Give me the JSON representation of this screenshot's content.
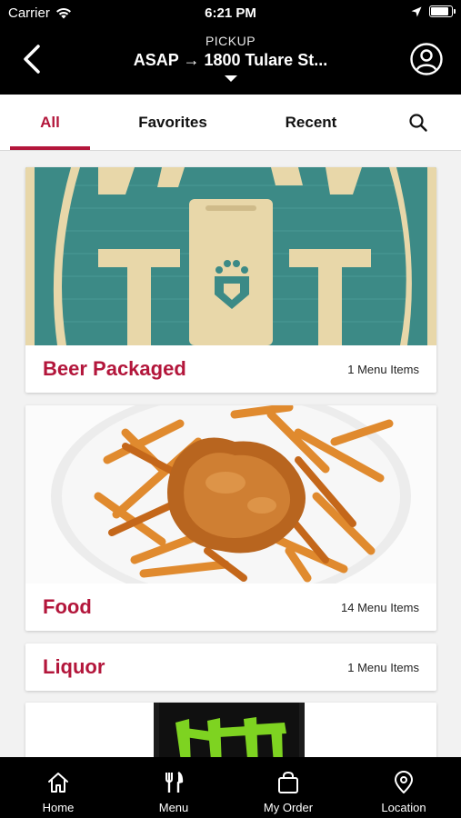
{
  "status_bar": {
    "carrier": "Carrier",
    "time": "6:21 PM",
    "battery_level": 0.92
  },
  "header": {
    "mode_label": "PICKUP",
    "destination": "ASAP → 1800 Tulare St..."
  },
  "tabs": [
    {
      "label": "All",
      "active": true
    },
    {
      "label": "Favorites",
      "active": false
    },
    {
      "label": "Recent",
      "active": false
    }
  ],
  "categories": [
    {
      "title": "Beer Packaged",
      "count": "1 Menu Items",
      "has_image": true
    },
    {
      "title": "Food",
      "count": "14 Menu Items",
      "has_image": true
    },
    {
      "title": "Liquor",
      "count": "1 Menu Items",
      "has_image": false
    }
  ],
  "bottom_nav": [
    {
      "label": "Home",
      "icon": "home-icon"
    },
    {
      "label": "Menu",
      "icon": "fork-knife-icon"
    },
    {
      "label": "My Order",
      "icon": "shopping-bag-icon"
    },
    {
      "label": "Location",
      "icon": "location-pin-icon"
    }
  ],
  "colors": {
    "accent": "#b3163b",
    "header_bg": "#000000"
  }
}
